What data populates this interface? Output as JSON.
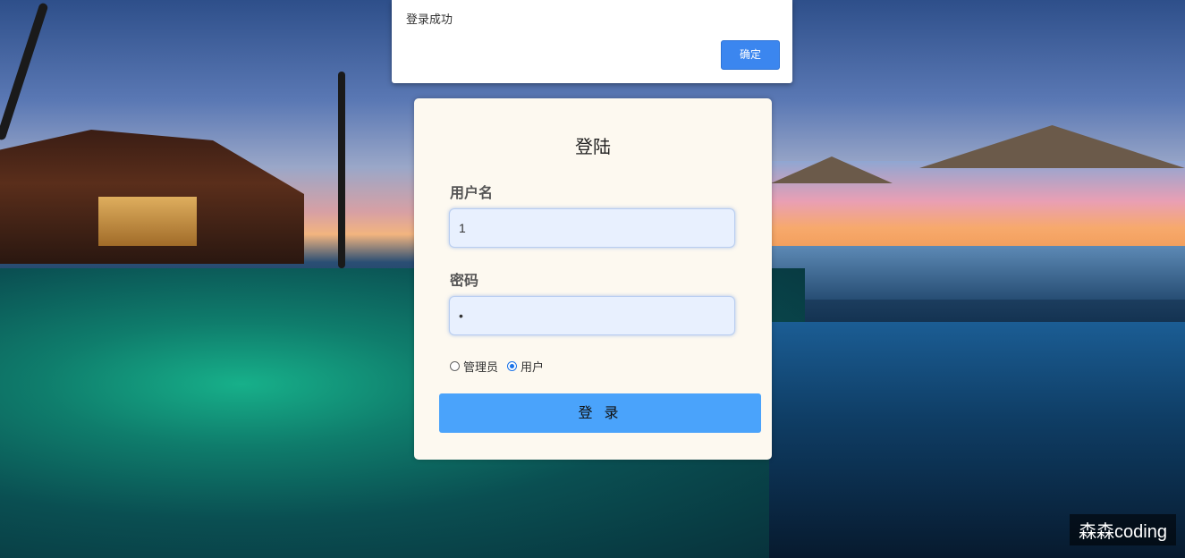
{
  "alert": {
    "message": "登录成功",
    "ok_label": "确定"
  },
  "login": {
    "title": "登陆",
    "username_label": "用户名",
    "username_value": "1",
    "password_label": "密码",
    "password_value": "•",
    "role_options": [
      "管理员",
      "用户"
    ],
    "role_selected": "用户",
    "submit_label": "登 录"
  },
  "watermark": "森森coding",
  "colors": {
    "accent": "#4aa3fb",
    "dialog_button": "#3b86ef",
    "card_background": "#fdf9f0",
    "input_background": "#e8f0fe"
  }
}
